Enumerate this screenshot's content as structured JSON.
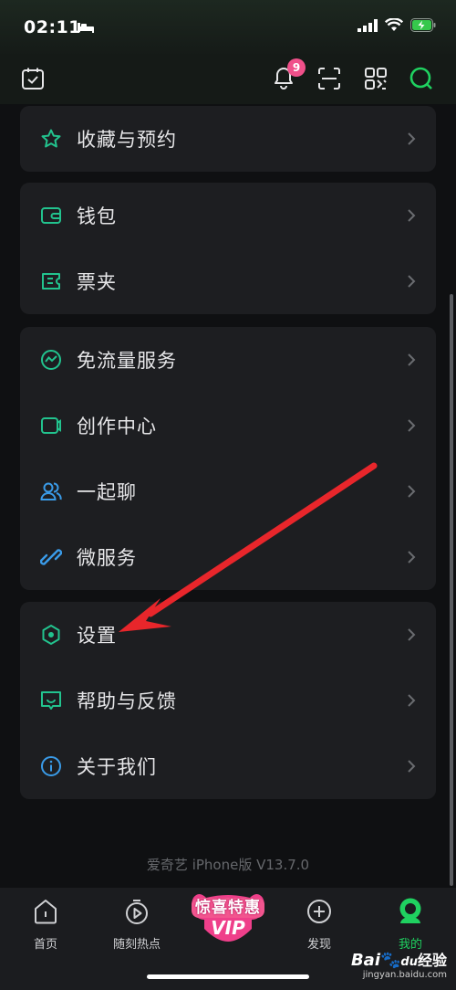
{
  "status": {
    "time": "02:11"
  },
  "top_bar": {
    "notification_count": "9"
  },
  "menu": {
    "group1": [
      {
        "label": "收藏与预约",
        "icon": "star-icon"
      }
    ],
    "group2": [
      {
        "label": "钱包",
        "icon": "wallet-icon"
      },
      {
        "label": "票夹",
        "icon": "ticket-icon"
      }
    ],
    "group3": [
      {
        "label": "免流量服务",
        "icon": "data-flow-icon"
      },
      {
        "label": "创作中心",
        "icon": "camera-icon"
      },
      {
        "label": "一起聊",
        "icon": "users-icon"
      },
      {
        "label": "微服务",
        "icon": "link-icon"
      }
    ],
    "group4": [
      {
        "label": "设置",
        "icon": "hexagon-settings-icon"
      },
      {
        "label": "帮助与反馈",
        "icon": "feedback-icon"
      },
      {
        "label": "关于我们",
        "icon": "info-icon"
      }
    ]
  },
  "version": "爱奇艺 iPhone版 V13.7.0",
  "tabs": [
    {
      "label": "首页",
      "icon": "home-icon"
    },
    {
      "label": "随刻热点",
      "icon": "timer-play-icon"
    },
    {
      "label": "发现",
      "icon": "plus-circle-icon"
    },
    {
      "label": "我的",
      "icon": "profile-icon",
      "active": true
    }
  ],
  "vip_promo": {
    "text": "惊喜特惠",
    "logo": "VIP"
  },
  "watermark": {
    "logo": "Bai",
    "logo_mid": "du",
    "logo_suffix": "经验",
    "url": "jingyan.baidu.com"
  },
  "colors": {
    "accent": "#1fd160",
    "badge": "#f0508a",
    "arrow": "#e8262b",
    "card": "#1d1e21"
  }
}
